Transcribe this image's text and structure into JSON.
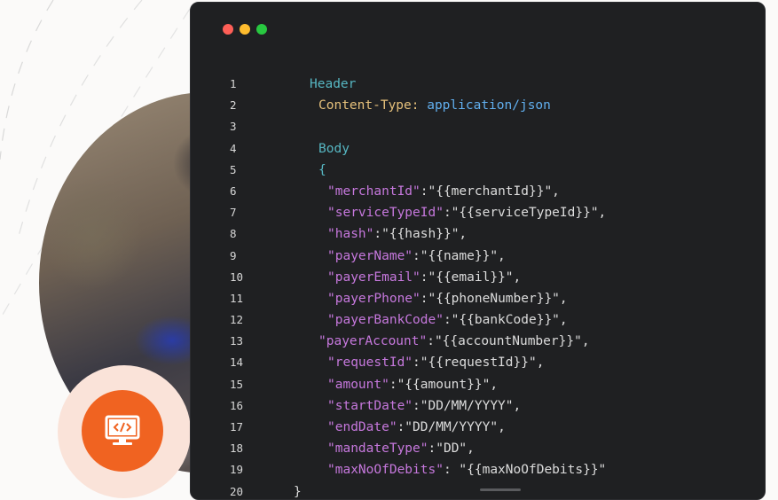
{
  "code": {
    "lines": [
      {
        "n": "1",
        "indent": 0,
        "parts": [
          {
            "c": "h",
            "t": "Header"
          }
        ]
      },
      {
        "n": "2",
        "indent": 1,
        "parts": [
          {
            "c": "y",
            "t": "Content-Type: "
          },
          {
            "c": "v",
            "t": "application/json"
          }
        ]
      },
      {
        "n": "3",
        "indent": 0,
        "parts": []
      },
      {
        "n": "4",
        "indent": 1,
        "parts": [
          {
            "c": "h",
            "t": "Body"
          }
        ]
      },
      {
        "n": "5",
        "indent": 1,
        "parts": [
          {
            "c": "h",
            "t": "{"
          }
        ]
      },
      {
        "n": "6",
        "indent": 2,
        "parts": [
          {
            "c": "k",
            "t": "\"merchantId\""
          },
          {
            "c": "s",
            "t": ":\"{{merchantId}}\","
          }
        ]
      },
      {
        "n": "7",
        "indent": 2,
        "parts": [
          {
            "c": "k",
            "t": "\"serviceTypeId\""
          },
          {
            "c": "s",
            "t": ":\"{{serviceTypeId}}\","
          }
        ]
      },
      {
        "n": "8",
        "indent": 2,
        "parts": [
          {
            "c": "k",
            "t": "\"hash\""
          },
          {
            "c": "s",
            "t": ":\"{{hash}}\","
          }
        ]
      },
      {
        "n": "9",
        "indent": 2,
        "parts": [
          {
            "c": "k",
            "t": "\"payerName\""
          },
          {
            "c": "s",
            "t": ":\"{{name}}\","
          }
        ]
      },
      {
        "n": "10",
        "indent": 2,
        "parts": [
          {
            "c": "k",
            "t": "\"payerEmail\""
          },
          {
            "c": "s",
            "t": ":\"{{email}}\","
          }
        ]
      },
      {
        "n": "11",
        "indent": 2,
        "parts": [
          {
            "c": "k",
            "t": "\"payerPhone\""
          },
          {
            "c": "s",
            "t": ":\"{{phoneNumber}}\","
          }
        ]
      },
      {
        "n": "12",
        "indent": 2,
        "parts": [
          {
            "c": "k",
            "t": "\"payerBankCode\""
          },
          {
            "c": "s",
            "t": ":\"{{bankCode}}\","
          }
        ]
      },
      {
        "n": "13",
        "indent": 1,
        "parts": [
          {
            "c": "k",
            "t": "\"payerAccount\""
          },
          {
            "c": "s",
            "t": ":\"{{accountNumber}}\","
          }
        ]
      },
      {
        "n": "14",
        "indent": 2,
        "parts": [
          {
            "c": "k",
            "t": "\"requestId\""
          },
          {
            "c": "s",
            "t": ":\"{{requestId}}\","
          }
        ]
      },
      {
        "n": "15",
        "indent": 2,
        "parts": [
          {
            "c": "k",
            "t": "\"amount\""
          },
          {
            "c": "s",
            "t": ":\"{{amount}}\","
          }
        ]
      },
      {
        "n": "16",
        "indent": 2,
        "parts": [
          {
            "c": "k",
            "t": "\"startDate\""
          },
          {
            "c": "s",
            "t": ":\"DD/MM/YYYY\","
          }
        ]
      },
      {
        "n": "17",
        "indent": 2,
        "parts": [
          {
            "c": "k",
            "t": "\"endDate\""
          },
          {
            "c": "s",
            "t": ":\"DD/MM/YYYY\","
          }
        ]
      },
      {
        "n": "18",
        "indent": 2,
        "parts": [
          {
            "c": "k",
            "t": "\"mandateType\""
          },
          {
            "c": "s",
            "t": ":\"DD\","
          }
        ]
      },
      {
        "n": "19",
        "indent": 2,
        "parts": [
          {
            "c": "k",
            "t": "\"maxNoOfDebits\""
          },
          {
            "c": "s",
            "t": ": \"{{maxNoOfDebits}}\""
          }
        ]
      },
      {
        "n": "20",
        "indent": 0,
        "parts": [
          {
            "c": "s",
            "t": "}"
          }
        ]
      }
    ]
  },
  "colors": {
    "window_bg": "#1f2022",
    "dot_red": "#fe5f57",
    "dot_yellow": "#febc2e",
    "dot_green": "#28c840",
    "badge_orange": "#f06321",
    "key_purple": "#c678dd",
    "header_cyan": "#56b6c2",
    "content_type_yellow": "#e5c07b"
  },
  "icons": {
    "badge_icon": "code-monitor-icon"
  }
}
